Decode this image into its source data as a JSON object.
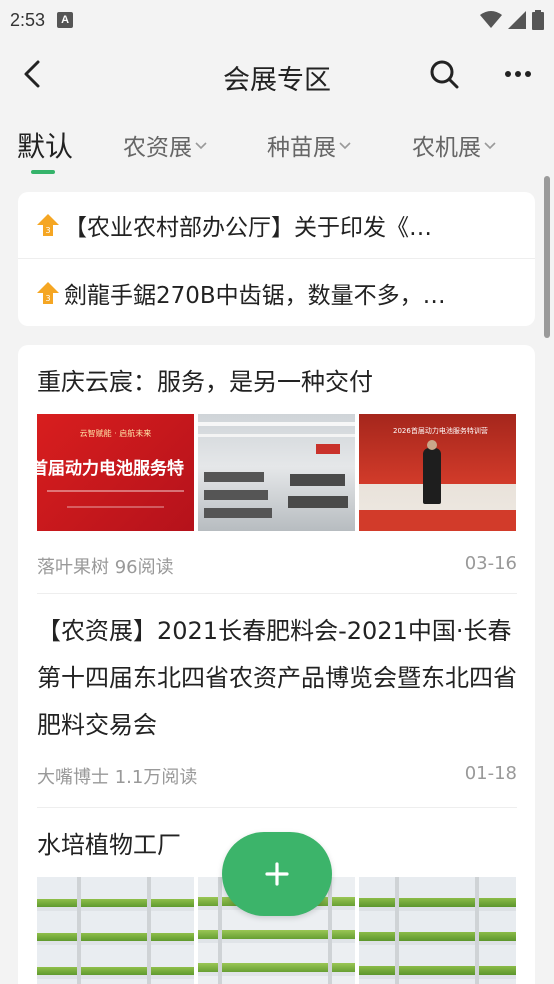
{
  "status_bar": {
    "time": "2:53",
    "notification_icon": "A"
  },
  "app_bar": {
    "title": "会展专区"
  },
  "tabs": [
    {
      "label": "默认",
      "active": true
    },
    {
      "label": "农资展",
      "active": false
    },
    {
      "label": "种苗展",
      "active": false
    },
    {
      "label": "农机展",
      "active": false
    }
  ],
  "notices": [
    {
      "badge": "3",
      "text": "【农业农村部办公厅】关于印发《…"
    },
    {
      "badge": "3",
      "text": "劍龍手鋸270B中齿锯，数量不多，…"
    }
  ],
  "articles": [
    {
      "title": "重庆云宸：服务，是另一种交付",
      "thumb_texts": {
        "banner_small": "云智赋能 · 启航未来",
        "banner_big": "首届动力电池服务特",
        "stage_banner": "2026首届动力电池服务特训营"
      },
      "author_reads": "落叶果树 96阅读",
      "date": "03-16"
    },
    {
      "title": "【农资展】2021长春肥料会-2021中国·长春第十四届东北四省农资产品博览会暨东北四省肥料交易会",
      "author_reads": "大嘴博士 1.1万阅读",
      "date": "01-18"
    },
    {
      "title": "水培植物工厂"
    }
  ],
  "colors": {
    "accent": "#35b36a",
    "fab": "#3cb46a",
    "badge": "#f5a623"
  }
}
